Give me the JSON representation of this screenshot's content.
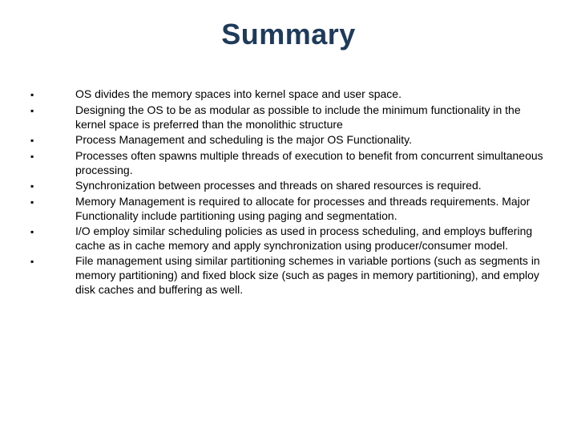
{
  "title": "Summary",
  "bullet_glyph": "▪",
  "items": [
    "OS divides the memory spaces into kernel space and user space.",
    "Designing the OS to be as modular as possible to include the minimum functionality in the kernel space is preferred than the monolithic structure",
    "Process Management and scheduling is the major OS Functionality.",
    "Processes often spawns multiple threads of execution to benefit from concurrent simultaneous processing.",
    "Synchronization between processes and threads on shared resources is required.",
    "Memory Management is required to allocate for processes and threads requirements. Major Functionality include partitioning using paging and segmentation.",
    "I/O employ similar scheduling policies as used in process scheduling, and employs buffering cache as in cache memory and apply synchronization using producer/consumer model.",
    "File management using similar partitioning schemes in variable portions (such as segments in memory partitioning) and fixed block size (such as pages in memory partitioning), and employ disk caches and buffering as well."
  ]
}
